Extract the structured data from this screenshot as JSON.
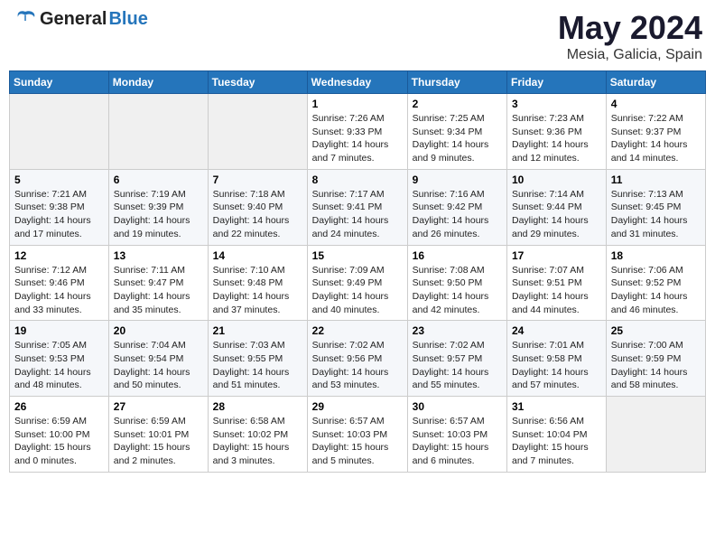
{
  "header": {
    "logo_general": "General",
    "logo_blue": "Blue",
    "month": "May 2024",
    "location": "Mesia, Galicia, Spain"
  },
  "weekdays": [
    "Sunday",
    "Monday",
    "Tuesday",
    "Wednesday",
    "Thursday",
    "Friday",
    "Saturday"
  ],
  "weeks": [
    [
      {
        "num": "",
        "text": ""
      },
      {
        "num": "",
        "text": ""
      },
      {
        "num": "",
        "text": ""
      },
      {
        "num": "1",
        "text": "Sunrise: 7:26 AM\nSunset: 9:33 PM\nDaylight: 14 hours\nand 7 minutes."
      },
      {
        "num": "2",
        "text": "Sunrise: 7:25 AM\nSunset: 9:34 PM\nDaylight: 14 hours\nand 9 minutes."
      },
      {
        "num": "3",
        "text": "Sunrise: 7:23 AM\nSunset: 9:36 PM\nDaylight: 14 hours\nand 12 minutes."
      },
      {
        "num": "4",
        "text": "Sunrise: 7:22 AM\nSunset: 9:37 PM\nDaylight: 14 hours\nand 14 minutes."
      }
    ],
    [
      {
        "num": "5",
        "text": "Sunrise: 7:21 AM\nSunset: 9:38 PM\nDaylight: 14 hours\nand 17 minutes."
      },
      {
        "num": "6",
        "text": "Sunrise: 7:19 AM\nSunset: 9:39 PM\nDaylight: 14 hours\nand 19 minutes."
      },
      {
        "num": "7",
        "text": "Sunrise: 7:18 AM\nSunset: 9:40 PM\nDaylight: 14 hours\nand 22 minutes."
      },
      {
        "num": "8",
        "text": "Sunrise: 7:17 AM\nSunset: 9:41 PM\nDaylight: 14 hours\nand 24 minutes."
      },
      {
        "num": "9",
        "text": "Sunrise: 7:16 AM\nSunset: 9:42 PM\nDaylight: 14 hours\nand 26 minutes."
      },
      {
        "num": "10",
        "text": "Sunrise: 7:14 AM\nSunset: 9:44 PM\nDaylight: 14 hours\nand 29 minutes."
      },
      {
        "num": "11",
        "text": "Sunrise: 7:13 AM\nSunset: 9:45 PM\nDaylight: 14 hours\nand 31 minutes."
      }
    ],
    [
      {
        "num": "12",
        "text": "Sunrise: 7:12 AM\nSunset: 9:46 PM\nDaylight: 14 hours\nand 33 minutes."
      },
      {
        "num": "13",
        "text": "Sunrise: 7:11 AM\nSunset: 9:47 PM\nDaylight: 14 hours\nand 35 minutes."
      },
      {
        "num": "14",
        "text": "Sunrise: 7:10 AM\nSunset: 9:48 PM\nDaylight: 14 hours\nand 37 minutes."
      },
      {
        "num": "15",
        "text": "Sunrise: 7:09 AM\nSunset: 9:49 PM\nDaylight: 14 hours\nand 40 minutes."
      },
      {
        "num": "16",
        "text": "Sunrise: 7:08 AM\nSunset: 9:50 PM\nDaylight: 14 hours\nand 42 minutes."
      },
      {
        "num": "17",
        "text": "Sunrise: 7:07 AM\nSunset: 9:51 PM\nDaylight: 14 hours\nand 44 minutes."
      },
      {
        "num": "18",
        "text": "Sunrise: 7:06 AM\nSunset: 9:52 PM\nDaylight: 14 hours\nand 46 minutes."
      }
    ],
    [
      {
        "num": "19",
        "text": "Sunrise: 7:05 AM\nSunset: 9:53 PM\nDaylight: 14 hours\nand 48 minutes."
      },
      {
        "num": "20",
        "text": "Sunrise: 7:04 AM\nSunset: 9:54 PM\nDaylight: 14 hours\nand 50 minutes."
      },
      {
        "num": "21",
        "text": "Sunrise: 7:03 AM\nSunset: 9:55 PM\nDaylight: 14 hours\nand 51 minutes."
      },
      {
        "num": "22",
        "text": "Sunrise: 7:02 AM\nSunset: 9:56 PM\nDaylight: 14 hours\nand 53 minutes."
      },
      {
        "num": "23",
        "text": "Sunrise: 7:02 AM\nSunset: 9:57 PM\nDaylight: 14 hours\nand 55 minutes."
      },
      {
        "num": "24",
        "text": "Sunrise: 7:01 AM\nSunset: 9:58 PM\nDaylight: 14 hours\nand 57 minutes."
      },
      {
        "num": "25",
        "text": "Sunrise: 7:00 AM\nSunset: 9:59 PM\nDaylight: 14 hours\nand 58 minutes."
      }
    ],
    [
      {
        "num": "26",
        "text": "Sunrise: 6:59 AM\nSunset: 10:00 PM\nDaylight: 15 hours\nand 0 minutes."
      },
      {
        "num": "27",
        "text": "Sunrise: 6:59 AM\nSunset: 10:01 PM\nDaylight: 15 hours\nand 2 minutes."
      },
      {
        "num": "28",
        "text": "Sunrise: 6:58 AM\nSunset: 10:02 PM\nDaylight: 15 hours\nand 3 minutes."
      },
      {
        "num": "29",
        "text": "Sunrise: 6:57 AM\nSunset: 10:03 PM\nDaylight: 15 hours\nand 5 minutes."
      },
      {
        "num": "30",
        "text": "Sunrise: 6:57 AM\nSunset: 10:03 PM\nDaylight: 15 hours\nand 6 minutes."
      },
      {
        "num": "31",
        "text": "Sunrise: 6:56 AM\nSunset: 10:04 PM\nDaylight: 15 hours\nand 7 minutes."
      },
      {
        "num": "",
        "text": ""
      }
    ]
  ]
}
